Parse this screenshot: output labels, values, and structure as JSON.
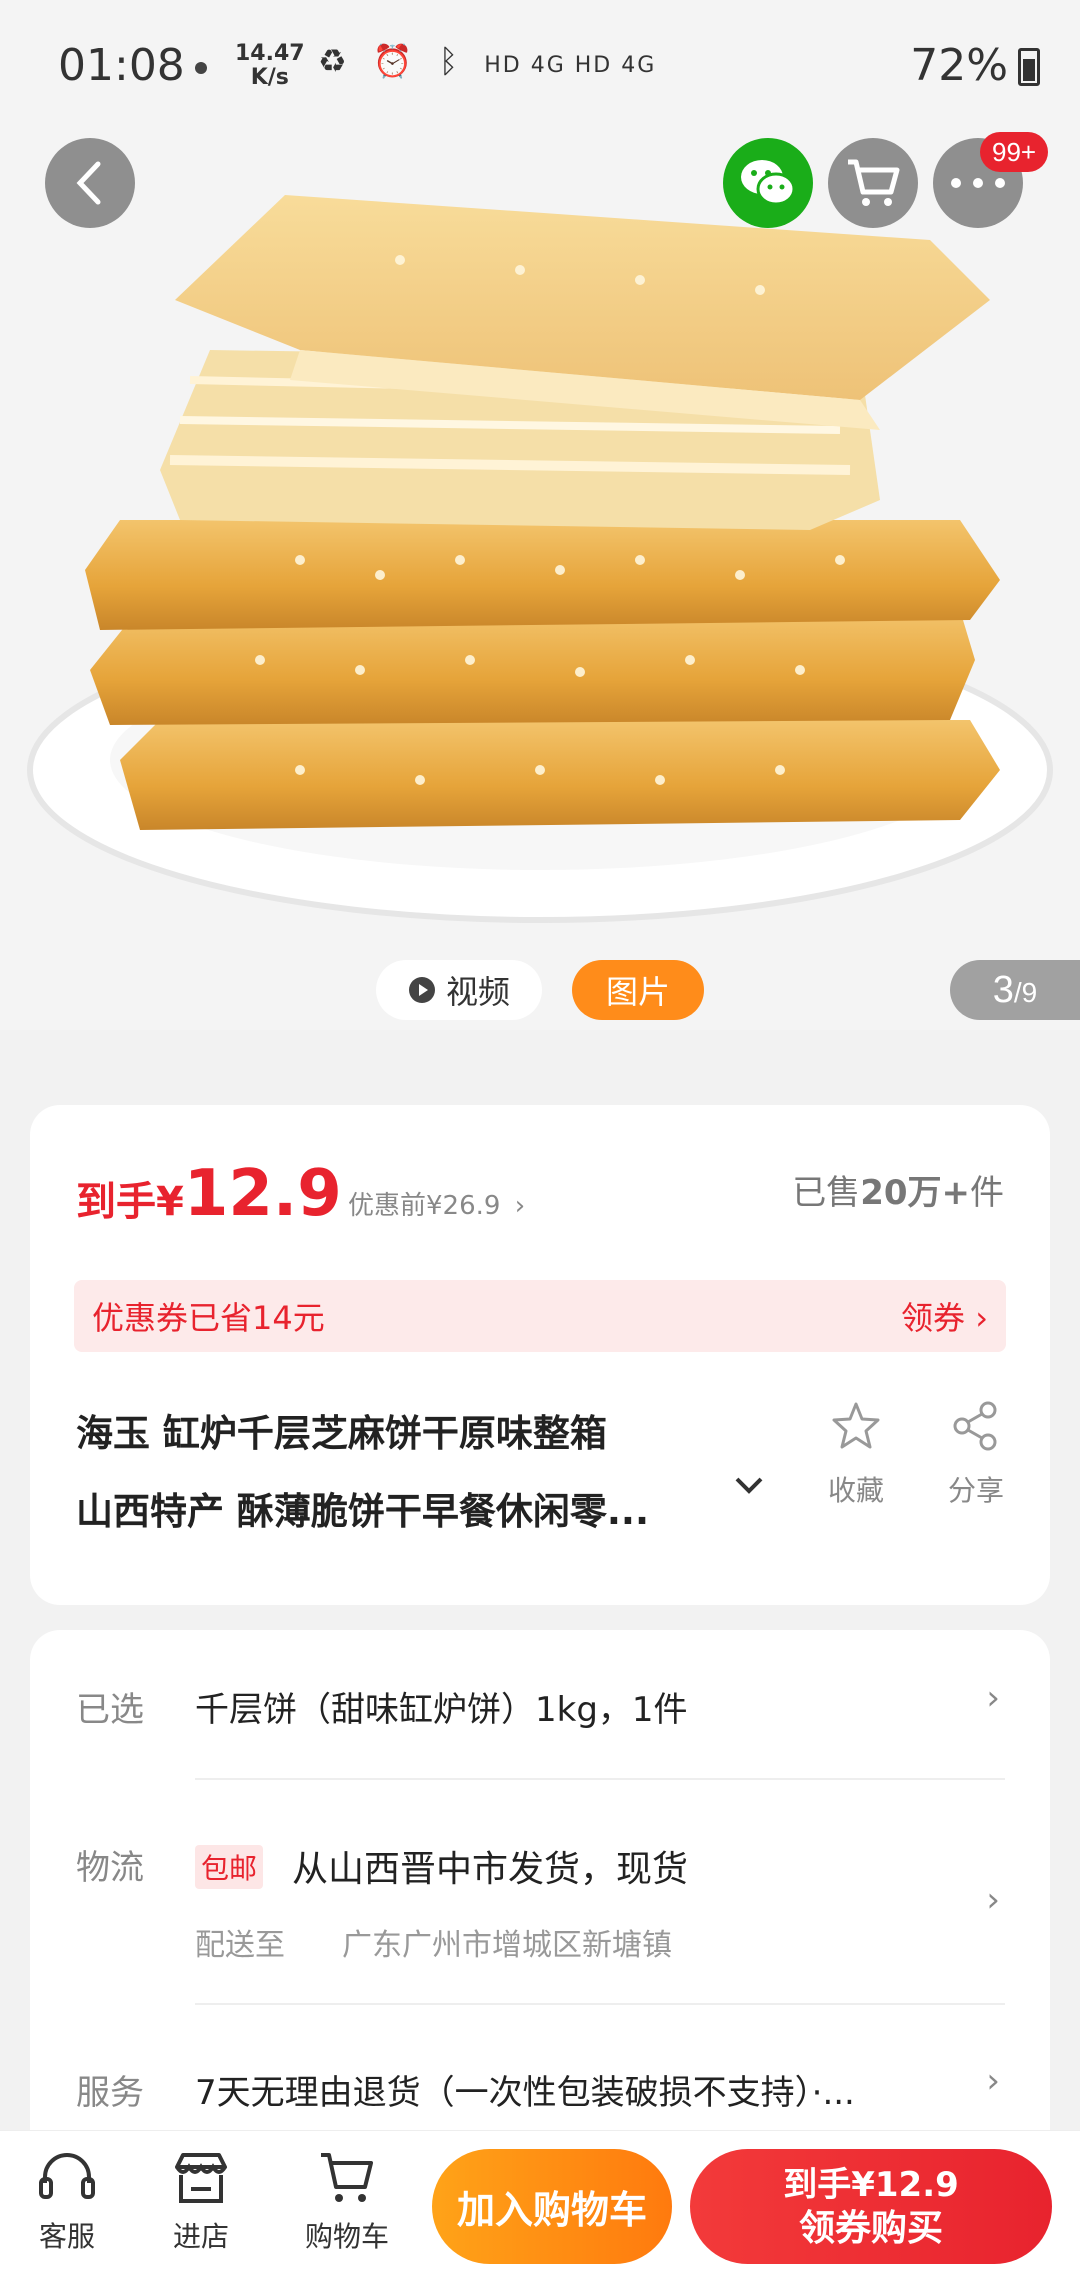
{
  "status": {
    "time": "01:08",
    "speed_value": "14.47",
    "speed_unit": "K/s",
    "network": "HD 4G HD 4G",
    "battery": "72%"
  },
  "hero": {
    "media_tabs": {
      "video_label": "视频",
      "image_label": "图片"
    },
    "counter": {
      "current": "3",
      "total": "/9"
    },
    "notif_badge": "99+"
  },
  "price": {
    "final_prefix": "到手¥",
    "final_value": "12.9",
    "original": "优惠前¥26.9",
    "sold_prefix": "已售",
    "sold_value": "20万+",
    "sold_suffix": "件",
    "coupon_text": "优惠券已省14元",
    "coupon_action": "领券"
  },
  "title": {
    "line1": "海玉 缸炉千层芝麻饼干原味整箱",
    "line2": "山西特产 酥薄脆饼干早餐休闲零...",
    "favorite_label": "收藏",
    "share_label": "分享"
  },
  "details": {
    "selected_label": "已选",
    "selected_value": "千层饼（甜味缸炉饼）1kg，1件",
    "shipping_label": "物流",
    "free_shipping_badge": "包邮",
    "shipping_value": "从山西晋中市发货，现货",
    "deliver_to_label": "配送至",
    "deliver_to_value": "广东广州市增城区新塘镇",
    "service_label": "服务",
    "service_value": "7天无理由退货（一次性包装破损不支持）·..."
  },
  "bottom": {
    "cs_label": "客服",
    "store_label": "进店",
    "cart_label": "购物车",
    "add_cart_label": "加入购物车",
    "buy_price": "到手¥12.9",
    "buy_label": "领券购买"
  },
  "colors": {
    "accent_red": "#e8232e",
    "accent_orange": "#ff8c1a",
    "wechat_green": "#1aad19"
  }
}
